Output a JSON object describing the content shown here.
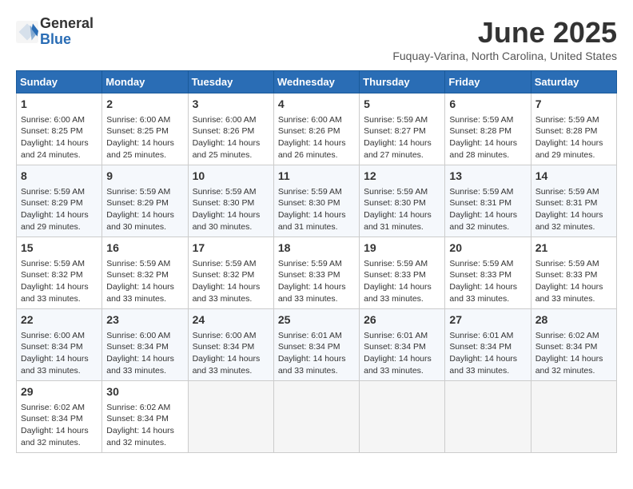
{
  "header": {
    "logo_general": "General",
    "logo_blue": "Blue",
    "title": "June 2025",
    "location": "Fuquay-Varina, North Carolina, United States"
  },
  "weekdays": [
    "Sunday",
    "Monday",
    "Tuesday",
    "Wednesday",
    "Thursday",
    "Friday",
    "Saturday"
  ],
  "weeks": [
    [
      {
        "day": "1",
        "info": "Sunrise: 6:00 AM\nSunset: 8:25 PM\nDaylight: 14 hours\nand 24 minutes."
      },
      {
        "day": "2",
        "info": "Sunrise: 6:00 AM\nSunset: 8:25 PM\nDaylight: 14 hours\nand 25 minutes."
      },
      {
        "day": "3",
        "info": "Sunrise: 6:00 AM\nSunset: 8:26 PM\nDaylight: 14 hours\nand 25 minutes."
      },
      {
        "day": "4",
        "info": "Sunrise: 6:00 AM\nSunset: 8:26 PM\nDaylight: 14 hours\nand 26 minutes."
      },
      {
        "day": "5",
        "info": "Sunrise: 5:59 AM\nSunset: 8:27 PM\nDaylight: 14 hours\nand 27 minutes."
      },
      {
        "day": "6",
        "info": "Sunrise: 5:59 AM\nSunset: 8:28 PM\nDaylight: 14 hours\nand 28 minutes."
      },
      {
        "day": "7",
        "info": "Sunrise: 5:59 AM\nSunset: 8:28 PM\nDaylight: 14 hours\nand 29 minutes."
      }
    ],
    [
      {
        "day": "8",
        "info": "Sunrise: 5:59 AM\nSunset: 8:29 PM\nDaylight: 14 hours\nand 29 minutes."
      },
      {
        "day": "9",
        "info": "Sunrise: 5:59 AM\nSunset: 8:29 PM\nDaylight: 14 hours\nand 30 minutes."
      },
      {
        "day": "10",
        "info": "Sunrise: 5:59 AM\nSunset: 8:30 PM\nDaylight: 14 hours\nand 30 minutes."
      },
      {
        "day": "11",
        "info": "Sunrise: 5:59 AM\nSunset: 8:30 PM\nDaylight: 14 hours\nand 31 minutes."
      },
      {
        "day": "12",
        "info": "Sunrise: 5:59 AM\nSunset: 8:30 PM\nDaylight: 14 hours\nand 31 minutes."
      },
      {
        "day": "13",
        "info": "Sunrise: 5:59 AM\nSunset: 8:31 PM\nDaylight: 14 hours\nand 32 minutes."
      },
      {
        "day": "14",
        "info": "Sunrise: 5:59 AM\nSunset: 8:31 PM\nDaylight: 14 hours\nand 32 minutes."
      }
    ],
    [
      {
        "day": "15",
        "info": "Sunrise: 5:59 AM\nSunset: 8:32 PM\nDaylight: 14 hours\nand 33 minutes."
      },
      {
        "day": "16",
        "info": "Sunrise: 5:59 AM\nSunset: 8:32 PM\nDaylight: 14 hours\nand 33 minutes."
      },
      {
        "day": "17",
        "info": "Sunrise: 5:59 AM\nSunset: 8:32 PM\nDaylight: 14 hours\nand 33 minutes."
      },
      {
        "day": "18",
        "info": "Sunrise: 5:59 AM\nSunset: 8:33 PM\nDaylight: 14 hours\nand 33 minutes."
      },
      {
        "day": "19",
        "info": "Sunrise: 5:59 AM\nSunset: 8:33 PM\nDaylight: 14 hours\nand 33 minutes."
      },
      {
        "day": "20",
        "info": "Sunrise: 5:59 AM\nSunset: 8:33 PM\nDaylight: 14 hours\nand 33 minutes."
      },
      {
        "day": "21",
        "info": "Sunrise: 5:59 AM\nSunset: 8:33 PM\nDaylight: 14 hours\nand 33 minutes."
      }
    ],
    [
      {
        "day": "22",
        "info": "Sunrise: 6:00 AM\nSunset: 8:34 PM\nDaylight: 14 hours\nand 33 minutes."
      },
      {
        "day": "23",
        "info": "Sunrise: 6:00 AM\nSunset: 8:34 PM\nDaylight: 14 hours\nand 33 minutes."
      },
      {
        "day": "24",
        "info": "Sunrise: 6:00 AM\nSunset: 8:34 PM\nDaylight: 14 hours\nand 33 minutes."
      },
      {
        "day": "25",
        "info": "Sunrise: 6:01 AM\nSunset: 8:34 PM\nDaylight: 14 hours\nand 33 minutes."
      },
      {
        "day": "26",
        "info": "Sunrise: 6:01 AM\nSunset: 8:34 PM\nDaylight: 14 hours\nand 33 minutes."
      },
      {
        "day": "27",
        "info": "Sunrise: 6:01 AM\nSunset: 8:34 PM\nDaylight: 14 hours\nand 33 minutes."
      },
      {
        "day": "28",
        "info": "Sunrise: 6:02 AM\nSunset: 8:34 PM\nDaylight: 14 hours\nand 32 minutes."
      }
    ],
    [
      {
        "day": "29",
        "info": "Sunrise: 6:02 AM\nSunset: 8:34 PM\nDaylight: 14 hours\nand 32 minutes."
      },
      {
        "day": "30",
        "info": "Sunrise: 6:02 AM\nSunset: 8:34 PM\nDaylight: 14 hours\nand 32 minutes."
      },
      {
        "day": "",
        "info": ""
      },
      {
        "day": "",
        "info": ""
      },
      {
        "day": "",
        "info": ""
      },
      {
        "day": "",
        "info": ""
      },
      {
        "day": "",
        "info": ""
      }
    ]
  ]
}
